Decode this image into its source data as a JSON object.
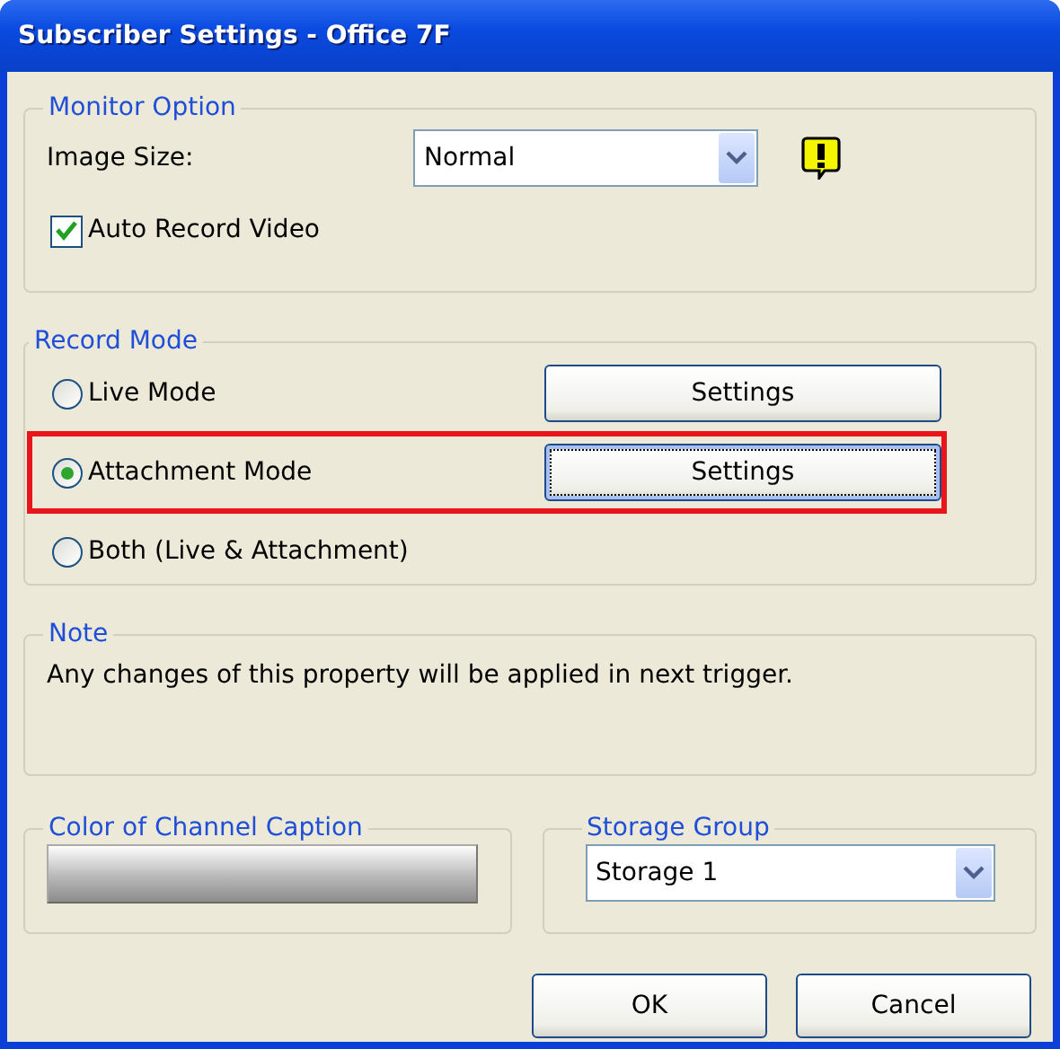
{
  "window": {
    "title": "Subscriber Settings - Office 7F"
  },
  "monitor_option": {
    "legend": "Monitor Option",
    "image_size_label": "Image Size:",
    "image_size": {
      "value": "Normal"
    },
    "auto_record_video": {
      "label": "Auto Record Video",
      "checked": true
    }
  },
  "record_mode": {
    "legend": "Record Mode",
    "options": [
      {
        "label": "Live Mode",
        "selected": false,
        "highlighted": false,
        "settings_button": {
          "label": "Settings",
          "focused": false
        }
      },
      {
        "label": "Attachment Mode",
        "selected": true,
        "highlighted": true,
        "settings_button": {
          "label": "Settings",
          "focused": true
        }
      },
      {
        "label": "Both (Live & Attachment)",
        "selected": false,
        "highlighted": false
      }
    ]
  },
  "note": {
    "legend": "Note",
    "text": "Any changes of this property will be applied in next trigger."
  },
  "channel_caption": {
    "legend": "Color of Channel Caption"
  },
  "storage_group": {
    "legend": "Storage Group",
    "value": "Storage 1"
  },
  "buttons": [
    {
      "label": "OK"
    },
    {
      "label": "Cancel"
    }
  ]
}
